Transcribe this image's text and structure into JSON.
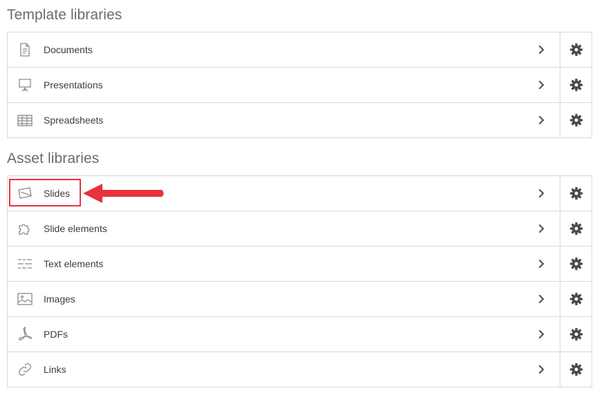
{
  "template_section": {
    "title": "Template libraries",
    "items": [
      {
        "label": "Documents",
        "icon": "document-icon"
      },
      {
        "label": "Presentations",
        "icon": "presentation-icon"
      },
      {
        "label": "Spreadsheets",
        "icon": "spreadsheet-icon"
      }
    ]
  },
  "asset_section": {
    "title": "Asset libraries",
    "items": [
      {
        "label": "Slides",
        "icon": "slides-icon"
      },
      {
        "label": "Slide elements",
        "icon": "puzzle-icon"
      },
      {
        "label": "Text elements",
        "icon": "text-lines-icon"
      },
      {
        "label": "Images",
        "icon": "image-icon"
      },
      {
        "label": "PDFs",
        "icon": "pdf-icon"
      },
      {
        "label": "Links",
        "icon": "link-icon"
      }
    ]
  },
  "annotation": {
    "highlight_color": "#e8323c"
  },
  "colors": {
    "icon": "#8a8a8a",
    "chevron": "#555555",
    "gear": "#4a4a4a",
    "border": "#d8d8d8"
  }
}
